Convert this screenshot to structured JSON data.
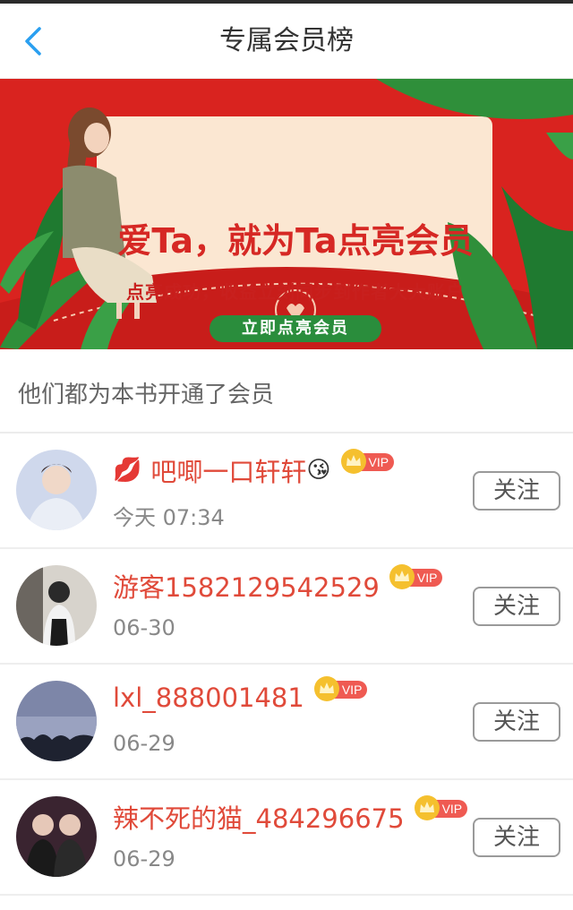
{
  "nav": {
    "title": "专属会员榜"
  },
  "banner": {
    "headline": "爱Ta，就为Ta点亮会员",
    "subtitle": "点亮成功，收益立刻同步到作者大大账户",
    "cta": "立即点亮会员",
    "colors": {
      "background": "#d9231f",
      "card": "#fbe7d2",
      "leaf": "#2f8f3a"
    }
  },
  "section": {
    "title": "他们都为本书开通了会员"
  },
  "members": [
    {
      "prefix_emoji": "💋",
      "name": "吧唧一口轩轩",
      "suffix_emoji": "😘",
      "badge": "VIP",
      "time": "今天 07:34",
      "follow": "关注"
    },
    {
      "prefix_emoji": "",
      "name": "游客1582129542529",
      "suffix_emoji": "",
      "badge": "VIP",
      "time": "06-30",
      "follow": "关注"
    },
    {
      "prefix_emoji": "",
      "name": "lxl_888001481",
      "suffix_emoji": "",
      "badge": "VIP",
      "time": "06-29",
      "follow": "关注"
    },
    {
      "prefix_emoji": "",
      "name": "辣不死的猫_484296675",
      "suffix_emoji": "",
      "badge": "VIP",
      "time": "06-29",
      "follow": "关注"
    }
  ],
  "colors": {
    "accent_name": "#e04a3a",
    "vip_badge": "#ef5a52",
    "back_arrow": "#2a9ff0"
  },
  "icons": {
    "back": "chevron-left-icon",
    "crown": "crown-icon"
  }
}
